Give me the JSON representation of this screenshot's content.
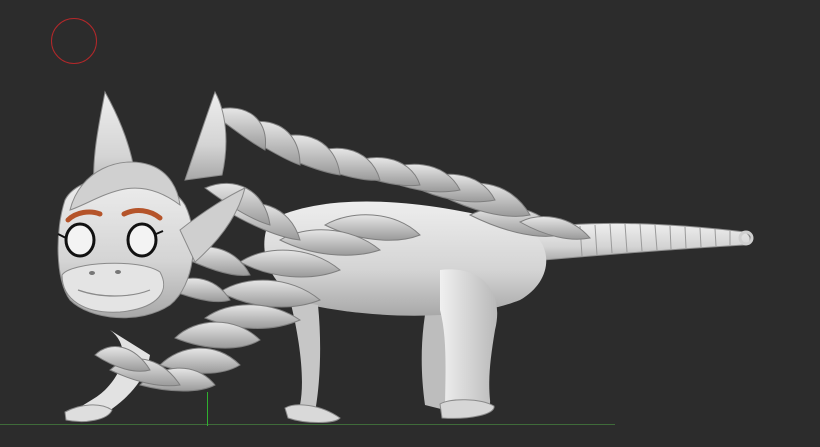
{
  "viewport": {
    "background_color": "#2c2c2c",
    "model_subject": "sculpted-creature",
    "model_color": "#d9d9d9",
    "brow_color": "#b5542a",
    "eye_outline_color": "#111111"
  },
  "brush_cursor": {
    "color": "#b3282a"
  },
  "floor_grid": {
    "color": "#3f6b3a"
  },
  "axis_gizmo": {
    "y_axis_color": "#2fb02f"
  }
}
